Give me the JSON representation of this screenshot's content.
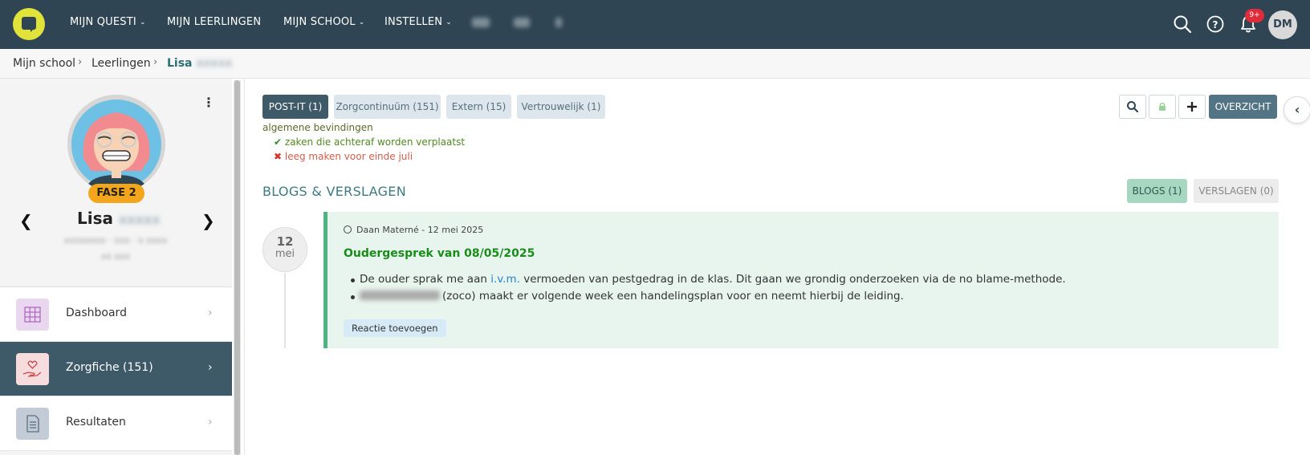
{
  "topnav": {
    "items": [
      {
        "label": "MIJN QUESTI",
        "has_dropdown": true
      },
      {
        "label": "MIJN LEERLINGEN",
        "has_dropdown": false
      },
      {
        "label": "MIJN SCHOOL",
        "has_dropdown": true
      },
      {
        "label": "INSTELLEN",
        "has_dropdown": true
      }
    ],
    "notification_badge": "9+",
    "user_initials": "DM"
  },
  "breadcrumb": {
    "items": [
      "Mijn school",
      "Leerlingen"
    ],
    "current": "Lisa"
  },
  "student": {
    "first_name": "Lisa",
    "fase": "FASE 2"
  },
  "sidebar": {
    "menu": [
      {
        "label": "Dashboard",
        "active": false,
        "icon": "grid-icon"
      },
      {
        "label": "Zorgfiche  (151)",
        "active": true,
        "icon": "hand-heart-icon"
      },
      {
        "label": "Resultaten",
        "active": false,
        "icon": "document-icon"
      }
    ]
  },
  "tabs": [
    {
      "label": "POST-IT (1)",
      "active": true
    },
    {
      "label": "Zorgcontinuüm (151)",
      "active": false
    },
    {
      "label": "Extern (15)",
      "active": false
    },
    {
      "label": "Vertrouwelijk (1)",
      "active": false
    }
  ],
  "toolbar": {
    "overzicht_label": "OVERZICHT"
  },
  "postit": {
    "title": "algemene bevindingen",
    "items": [
      {
        "mark": "✔",
        "text": "zaken die achteraf worden verplaatst",
        "status": "ok"
      },
      {
        "mark": "✖",
        "text": "leeg maken voor einde juli",
        "status": "x"
      }
    ]
  },
  "blogs_section": {
    "title": "BLOGS & VERSLAGEN",
    "blogs_btn": "BLOGS (1)",
    "verslagen_btn": "VERSLAGEN (0)"
  },
  "blog": {
    "date_day": "12",
    "date_month": "mei",
    "meta": "Daan Materné - 12 mei 2025",
    "title": "Oudergesprek van 08/05/2025",
    "bullet1_pre": "De ouder sprak me aan ",
    "bullet1_link": "i.v.m.",
    "bullet1_post": " vermoeden van pestgedrag in de klas.  Dit gaan we grondig onderzoeken via de no blame-methode.",
    "bullet2_post": "(zoco) maakt er volgende week een handelingsplan voor en neemt hierbij de leiding.",
    "reactie_label": "Reactie toevoegen"
  },
  "colors": {
    "nav_bg": "#2f4553",
    "accent_green": "#4db383",
    "active_menu": "#3e5a69",
    "logo": "#e1e33a"
  }
}
